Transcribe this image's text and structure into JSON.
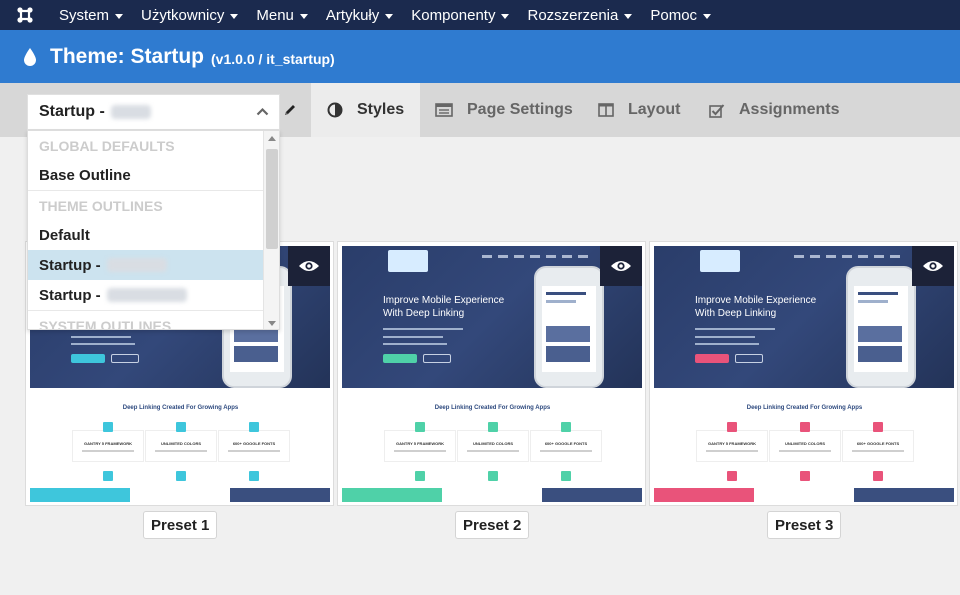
{
  "topnav": {
    "items": [
      "System",
      "Użytkownicy",
      "Menu",
      "Artykuły",
      "Komponenty",
      "Rozszerzenia",
      "Pomoc"
    ]
  },
  "title": {
    "main": "Theme: Startup",
    "sub": "(v1.0.0 / it_startup)"
  },
  "tabs": [
    {
      "label": "Styles",
      "icon": "half-circle-icon",
      "active": true
    },
    {
      "label": "Page Settings",
      "icon": "list-card-icon",
      "active": false
    },
    {
      "label": "Layout",
      "icon": "columns-icon",
      "active": false
    },
    {
      "label": "Assignments",
      "icon": "checkbox-icon",
      "active": false
    }
  ],
  "dropdown": {
    "selected": "Startup -",
    "groups": {
      "global": "GLOBAL DEFAULTS",
      "theme": "THEME OUTLINES",
      "system": "SYSTEM OUTLINES"
    },
    "options": {
      "base": "Base Outline",
      "default": "Default",
      "startup1": "Startup -",
      "startup2": "Startup -"
    }
  },
  "presets": [
    {
      "label": "Preset 1",
      "accent": "#3ec6dc"
    },
    {
      "label": "Preset 2",
      "accent": "#4fd1a8"
    },
    {
      "label": "Preset 3",
      "accent": "#e9537a"
    }
  ],
  "preview": {
    "hero_title": "Improve Mobile Experience With Deep Linking",
    "section_title": "Deep Linking Created For Growing Apps",
    "features": [
      "GANTRY 5 FRAMEWORK",
      "UNLIMITED COLORS",
      "600+ GOOGLE FONTS"
    ]
  },
  "colors": {
    "topnav": "#1b2a4e",
    "titlebar": "#2f7bd0",
    "dark_blue": "#3a4f7f"
  }
}
